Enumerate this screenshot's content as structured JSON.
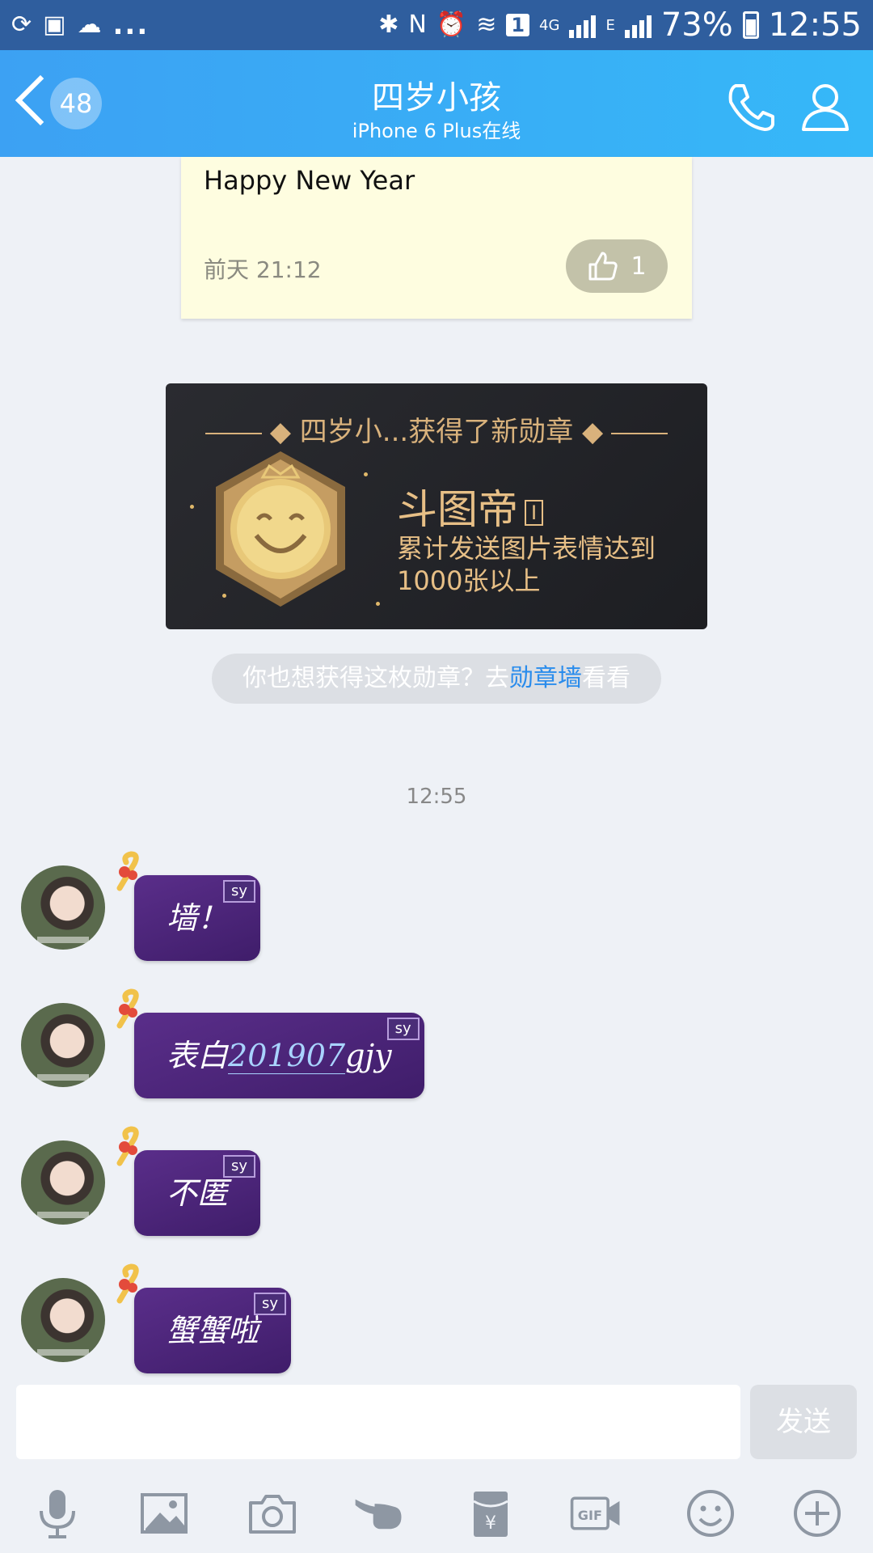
{
  "status_bar": {
    "notification_dots": "...",
    "sim_badge": "1",
    "network_4g": "4G",
    "network_e": "E",
    "battery": "73%",
    "clock": "12:55"
  },
  "header": {
    "back_count": "48",
    "title": "四岁小孩",
    "subtitle": "iPhone 6 Plus在线"
  },
  "note_card": {
    "text": "Happy New Year",
    "time": "前天 21:12",
    "likes": "1"
  },
  "medal_card": {
    "headline": "◆ 四岁小...获得了新勋章 ◆",
    "name": "斗图帝",
    "level": "I",
    "desc_line1": "累计发送图片表情达到",
    "desc_line2": "1000张以上"
  },
  "medal_hint": {
    "prefix": "你也想获得这枚勋章？去",
    "link": "勋章墙",
    "suffix": "看看"
  },
  "time_divider": "12:55",
  "messages": [
    {
      "text": "墙！",
      "tag": "sy"
    },
    {
      "text": "表白",
      "underlined": "201907",
      "tail": "gjy",
      "tag": "sy"
    },
    {
      "text": "不匿",
      "tag": "sy"
    },
    {
      "text": "蟹蟹啦",
      "tag": "sy"
    }
  ],
  "input": {
    "value": "",
    "send_label": "发送"
  },
  "toolbar_icons": [
    "microphone-icon",
    "image-icon",
    "camera-icon",
    "poke-icon",
    "red-packet-icon",
    "gif-icon",
    "emoji-icon",
    "plus-icon"
  ],
  "colors": {
    "header_gradient_start": "#3ca1f3",
    "header_gradient_end": "#36b8f8",
    "status_bar": "#2f5e9e",
    "bubble_purple": "#4a2578",
    "medal_gold": "#e7bf86",
    "link_blue": "#2a8cec"
  }
}
